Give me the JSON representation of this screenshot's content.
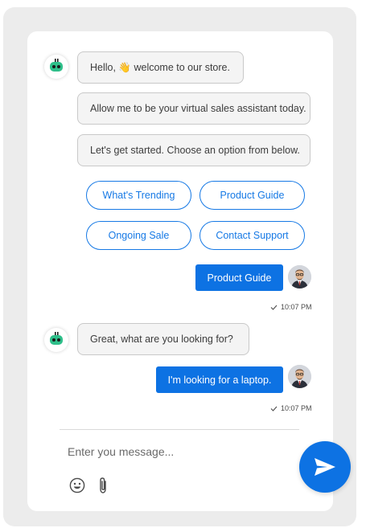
{
  "conversation": {
    "bot_messages": [
      "Hello, 👋 welcome to our store.",
      "Allow me to be your virtual sales assistant today.",
      "Let's get started. Choose an option from below."
    ],
    "options": [
      "What's Trending",
      "Product Guide",
      "Ongoing Sale",
      "Contact Support"
    ],
    "user_message_1": "Product Guide",
    "time_1": "10:07 PM",
    "bot_reply": "Great, what are you looking for?",
    "user_message_2": "I'm looking for a laptop.",
    "time_2": "10:07 PM"
  },
  "composer": {
    "placeholder": "Enter you message..."
  },
  "icons": {
    "bot": "robot-icon",
    "emoji": "smiley-icon",
    "attach": "paperclip-icon",
    "send": "send-icon",
    "check": "check-icon"
  },
  "colors": {
    "accent": "#0d72e3",
    "bot_icon": "#2fbf8a",
    "bubble_bg": "#f4f4f4"
  }
}
